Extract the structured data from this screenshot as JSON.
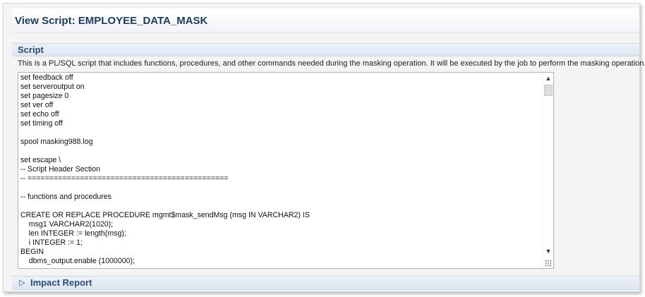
{
  "page": {
    "title": "View Script: EMPLOYEE_DATA_MASK"
  },
  "script_section": {
    "title": "Script",
    "description": "This is a PL/SQL script that includes functions, procedures, and other commands needed during the masking operation. It will be executed by the job to perform the masking operation.",
    "content": "set feedback off\nset serveroutput on\nset pagesize 0\nset ver off\nset echo off\nset timing off\n\nspool masking988.log\n\nset escape \\\n-- Script Header Section\n-- ==============================================\n\n-- functions and procedures\n\nCREATE OR REPLACE PROCEDURE mgmt$mask_sendMsg (msg IN VARCHAR2) IS\n    msg1 VARCHAR2(1020);\n    len INTEGER := length(msg);\n    i INTEGER := 1;\nBEGIN\n    dbms_output.enable (1000000);"
  },
  "scrollbar": {
    "up_icon": "▲",
    "down_icon": "▼"
  },
  "impact_section": {
    "disclosure_icon": "▷",
    "title": "Impact Report"
  }
}
